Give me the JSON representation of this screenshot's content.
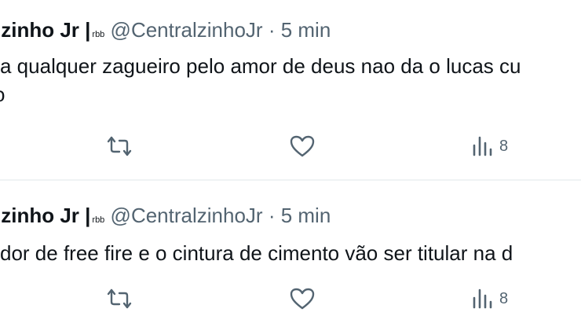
{
  "tweets": [
    {
      "display_name": "lzinho Jr |",
      "badge": "rbb",
      "handle": "@CentralzinhoJr",
      "separator": "·",
      "time": "5 min",
      "text_line1": "a qualquer zagueiro pelo amor de deus nao da o lucas cu",
      "text_line2": "o",
      "views": "8"
    },
    {
      "display_name": "lzinho Jr |",
      "badge": "rbb",
      "handle": "@CentralzinhoJr",
      "separator": "·",
      "time": "5 min",
      "text_line1": "dor de free fire e o cintura de cimento vão ser titular na d",
      "views": "8"
    }
  ],
  "icons": {
    "retweet": "retweet-icon",
    "like": "heart-icon",
    "views": "views-chart-icon"
  },
  "colors": {
    "text": "#0f1419",
    "secondary": "#536471",
    "divider": "#eff3f4"
  }
}
